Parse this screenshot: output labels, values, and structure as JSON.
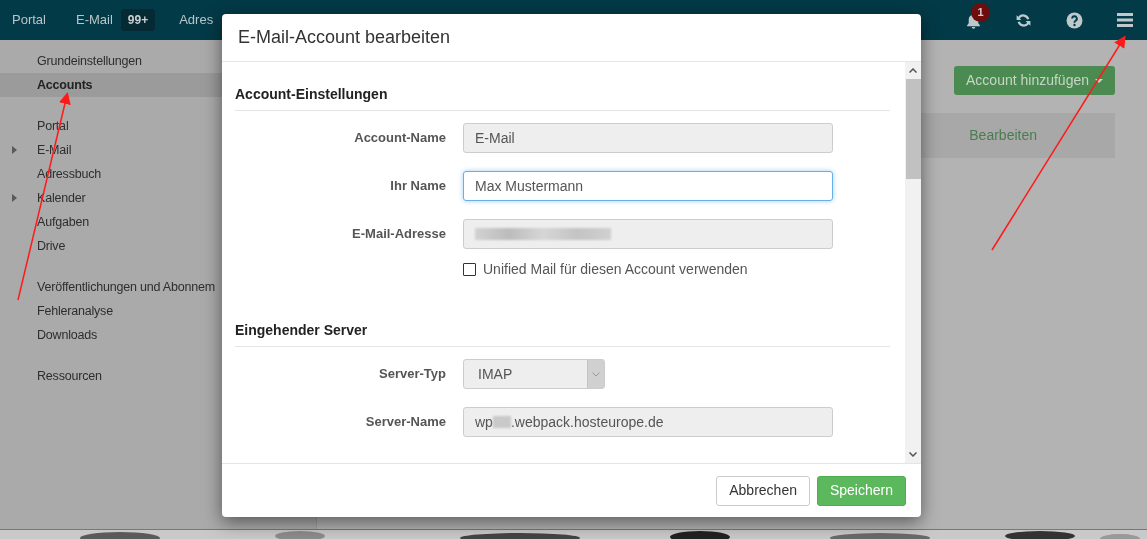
{
  "top_nav": {
    "items": [
      {
        "label": "Portal"
      },
      {
        "label": "E-Mail",
        "badge": "99+"
      },
      {
        "label": "Adres"
      }
    ],
    "notification_count": "1"
  },
  "sidebar": {
    "groups": [
      [
        {
          "label": "Grundeinstellungen",
          "kind": "plain",
          "selected": false
        },
        {
          "label": "Accounts",
          "kind": "plain",
          "selected": true
        }
      ],
      [
        {
          "label": "Portal",
          "kind": "plain",
          "selected": false
        },
        {
          "label": "E-Mail",
          "kind": "expandable",
          "selected": false
        },
        {
          "label": "Adressbuch",
          "kind": "plain",
          "selected": false
        },
        {
          "label": "Kalender",
          "kind": "expandable",
          "selected": false
        },
        {
          "label": "Aufgaben",
          "kind": "plain",
          "selected": false
        },
        {
          "label": "Drive",
          "kind": "plain",
          "selected": false
        }
      ],
      [
        {
          "label": "Veröffentlichungen und Abonnem",
          "kind": "plain",
          "selected": false
        },
        {
          "label": "Fehleranalyse",
          "kind": "plain",
          "selected": false
        },
        {
          "label": "Downloads",
          "kind": "plain",
          "selected": false
        }
      ],
      [
        {
          "label": "Ressourcen",
          "kind": "plain",
          "selected": false
        }
      ]
    ]
  },
  "main": {
    "add_button": "Account hinzufügen",
    "row_action": "Bearbeiten"
  },
  "dialog": {
    "title": "E-Mail-Account bearbeiten",
    "sections": [
      {
        "title": "Account-Einstellungen",
        "fields": [
          {
            "label": "Account-Name",
            "kind": "text",
            "value": "E-Mail",
            "disabled": true,
            "focused": false
          },
          {
            "label": "Ihr Name",
            "kind": "text",
            "value": "Max Mustermann",
            "disabled": false,
            "focused": true
          },
          {
            "label": "E-Mail-Adresse",
            "kind": "text",
            "redacted": true,
            "disabled": true,
            "focused": false
          },
          {
            "label": "Unified Mail für diesen Account verwenden",
            "kind": "checkbox",
            "checked": false
          }
        ]
      },
      {
        "title": "Eingehender Server",
        "fields": [
          {
            "label": "Server-Typ",
            "kind": "select",
            "value": "IMAP",
            "disabled": true,
            "focused": false
          },
          {
            "label": "Server-Name",
            "kind": "text",
            "value": "wp",
            "value_after": ".webpack.hosteurope.de",
            "redacted": true,
            "disabled": true,
            "focused": false
          }
        ]
      }
    ],
    "buttons": [
      {
        "label": "Abbrechen",
        "kind": "default"
      },
      {
        "label": "Speichern",
        "kind": "primary"
      }
    ]
  }
}
